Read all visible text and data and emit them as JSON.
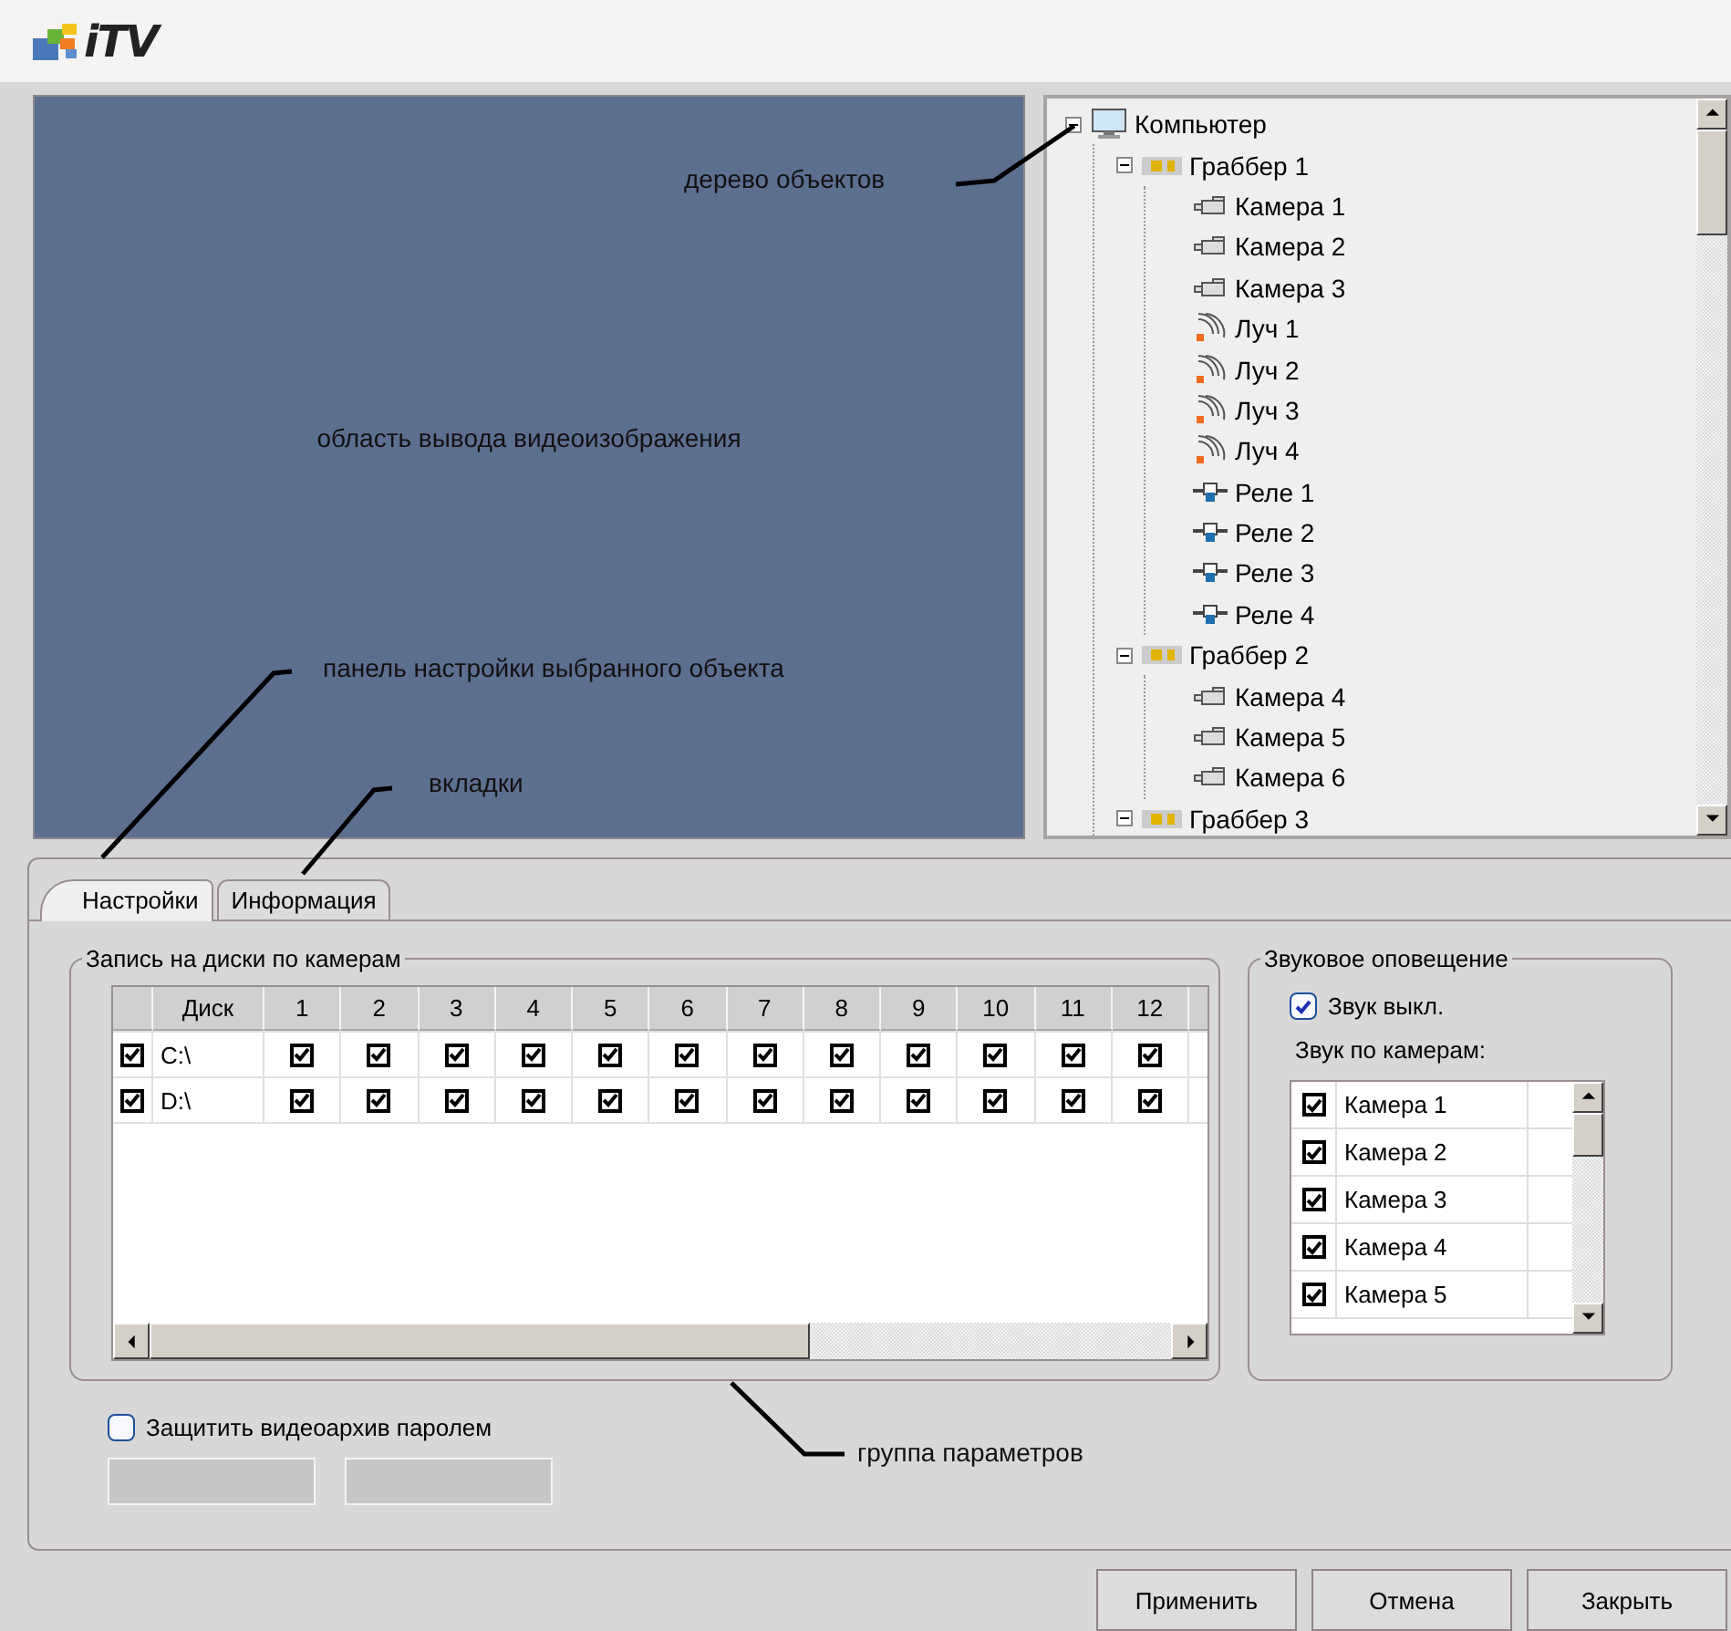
{
  "header": {
    "logo_text": "iTV"
  },
  "video_area": {
    "label": "область вывода видеоизображения"
  },
  "tree": {
    "nodes": [
      {
        "kind": "computer",
        "label": "Компьютер",
        "expanded": true,
        "children": [
          {
            "kind": "grabber",
            "label": "Граббер 1",
            "expanded": true,
            "children": [
              {
                "kind": "camera",
                "label": "Камера 1"
              },
              {
                "kind": "camera",
                "label": "Камера 2"
              },
              {
                "kind": "camera",
                "label": "Камера 3"
              },
              {
                "kind": "ray",
                "label": "Луч 1"
              },
              {
                "kind": "ray",
                "label": "Луч 2"
              },
              {
                "kind": "ray",
                "label": "Луч 3"
              },
              {
                "kind": "ray",
                "label": "Луч 4"
              },
              {
                "kind": "relay",
                "label": "Реле 1"
              },
              {
                "kind": "relay",
                "label": "Реле 2"
              },
              {
                "kind": "relay",
                "label": "Реле 3"
              },
              {
                "kind": "relay",
                "label": "Реле 4"
              }
            ]
          },
          {
            "kind": "grabber",
            "label": "Граббер 2",
            "expanded": true,
            "children": [
              {
                "kind": "camera",
                "label": "Камера 4"
              },
              {
                "kind": "camera",
                "label": "Камера 5"
              },
              {
                "kind": "camera",
                "label": "Камера 6"
              }
            ]
          },
          {
            "kind": "grabber",
            "label": "Граббер 3",
            "expanded": true
          }
        ]
      }
    ]
  },
  "tabs": [
    {
      "label": "Настройки",
      "selected": true
    },
    {
      "label": "Информация",
      "selected": false
    }
  ],
  "disk_group": {
    "title": "Запись на диски по камерам",
    "columns": [
      "Диск",
      "1",
      "2",
      "3",
      "4",
      "5",
      "6",
      "7",
      "8",
      "9",
      "10",
      "11",
      "12"
    ],
    "rows": [
      {
        "checked": true,
        "disk": "C:\\",
        "cameras": [
          true,
          true,
          true,
          true,
          true,
          true,
          true,
          true,
          true,
          true,
          true,
          true
        ]
      },
      {
        "checked": true,
        "disk": "D:\\",
        "cameras": [
          true,
          true,
          true,
          true,
          true,
          true,
          true,
          true,
          true,
          true,
          true,
          true
        ]
      }
    ]
  },
  "sound_group": {
    "title": "Звуковое оповещение",
    "mute": {
      "label": "Звук выкл.",
      "checked": true
    },
    "list_label": "Звук по камерам:",
    "cameras": [
      {
        "label": "Камера 1",
        "checked": true
      },
      {
        "label": "Камера 2",
        "checked": true
      },
      {
        "label": "Камера 3",
        "checked": true
      },
      {
        "label": "Камера 4",
        "checked": true
      },
      {
        "label": "Камера 5",
        "checked": true
      }
    ]
  },
  "password": {
    "label": "Защитить видеоархив паролем",
    "checked": false,
    "fields": [
      {
        "disabled": true
      },
      {
        "disabled": true
      }
    ]
  },
  "buttons": [
    "Применить",
    "Отмена",
    "Закрыть"
  ],
  "annotations": [
    {
      "text": "дерево объектов"
    },
    {
      "text": "панель настройки выбранного объекта"
    },
    {
      "text": "вкладки"
    },
    {
      "text": "группа параметров"
    }
  ]
}
